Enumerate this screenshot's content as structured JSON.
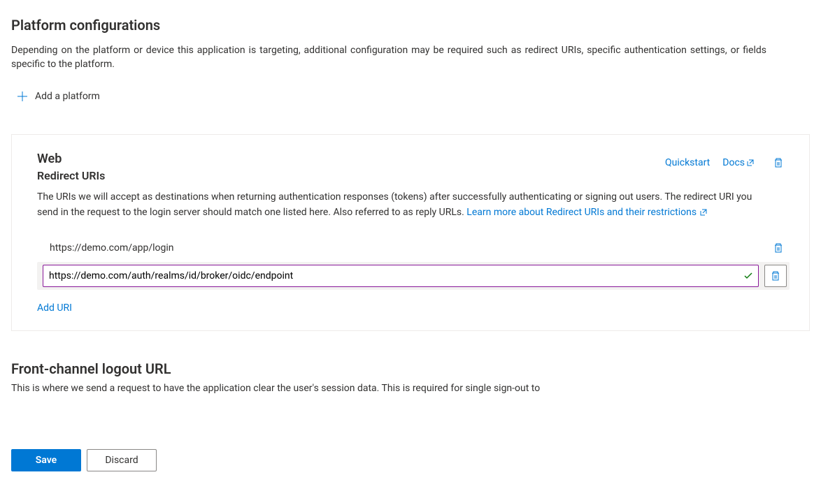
{
  "page": {
    "title": "Platform configurations",
    "description": "Depending on the platform or device this application is targeting, additional configuration may be required such as redirect URIs, specific authentication settings, or fields specific to the platform.",
    "add_platform_label": "Add a platform"
  },
  "web_panel": {
    "title": "Web",
    "subtitle": "Redirect URIs",
    "quickstart_label": "Quickstart",
    "docs_label": "Docs",
    "description_part1": "The URIs we will accept as destinations when returning authentication responses (tokens) after successfully authenticating or signing out users. The redirect URI you send in the request to the login server should match one listed here. Also referred to as reply URLs. ",
    "learn_more_label": "Learn more about Redirect URIs and their restrictions",
    "uris": {
      "existing": "https://demo.com/app/login",
      "editing": "https://demo.com/auth/realms/id/broker/oidc/endpoint"
    },
    "add_uri_label": "Add URI"
  },
  "logout_section": {
    "title": "Front-channel logout URL",
    "description": "This is where we send a request to have the application clear the user's session data. This is required for single sign-out to"
  },
  "footer": {
    "save_label": "Save",
    "discard_label": "Discard"
  }
}
